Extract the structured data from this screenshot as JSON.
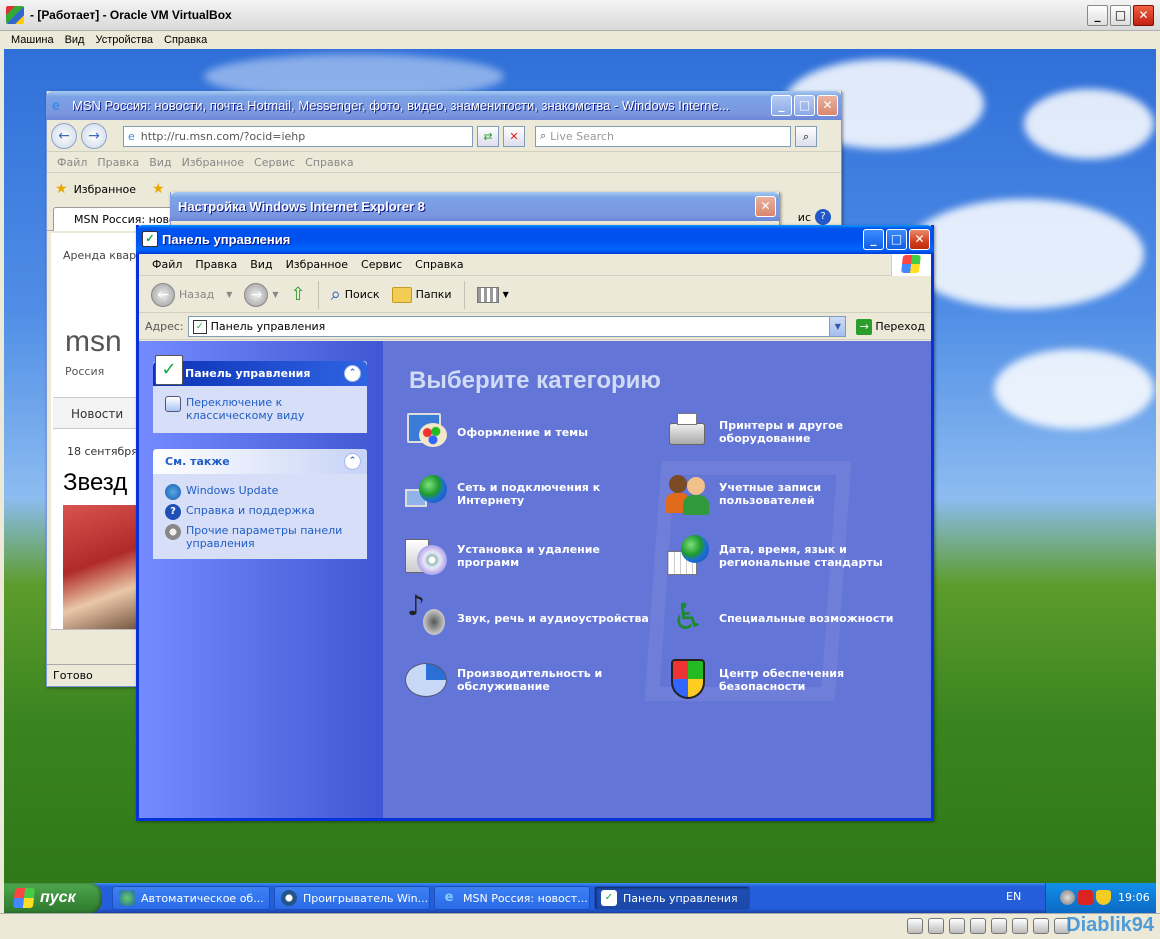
{
  "host": {
    "title": "- [Работает] - Oracle VM VirtualBox",
    "menu": [
      "Машина",
      "Вид",
      "Устройства",
      "Справка"
    ],
    "watermark": "Diablik94"
  },
  "ie": {
    "title": "MSN Россия: новости, почта Hotmail, Messenger, фото, видео, знаменитости, знакомства - Windows Interne...",
    "url": "http://ru.msn.com/?ocid=iehp",
    "search_placeholder": "Live Search",
    "menu": [
      "Файл",
      "Правка",
      "Вид",
      "Избранное",
      "Сервис",
      "Справка"
    ],
    "favorites_label": "Избранное",
    "tab_label": "MSN Россия: новос",
    "page_items": [
      "Аренда кварт",
      "msn",
      "Россия",
      "Новости",
      "18 сентября",
      "Звезд"
    ],
    "status": "Готово",
    "right_menu": "ис"
  },
  "dialog": {
    "title": "Настройка Windows Internet Explorer 8"
  },
  "cp": {
    "title": "Панель управления",
    "menu": [
      "Файл",
      "Правка",
      "Вид",
      "Избранное",
      "Сервис",
      "Справка"
    ],
    "toolbar": {
      "back": "Назад",
      "search": "Поиск",
      "folders": "Папки"
    },
    "address_label": "Адрес:",
    "address_value": "Панель управления",
    "go_label": "Переход",
    "left_panel": {
      "title": "Панель управления",
      "switch_link": "Переключение к классическому виду"
    },
    "see_also": {
      "title": "См. также",
      "links": [
        "Windows Update",
        "Справка и поддержка",
        "Прочие параметры панели управления"
      ]
    },
    "heading": "Выберите категорию",
    "categories": [
      "Оформление и темы",
      "Принтеры и другое оборудование",
      "Сеть и подключения к Интернету",
      "Учетные записи пользователей",
      "Установка и удаление программ",
      "Дата, время, язык и региональные стандарты",
      "Звук, речь и аудиоустройства",
      "Специальные возможности",
      "Производительность и обслуживание",
      "Центр обеспечения безопасности"
    ]
  },
  "taskbar": {
    "start": "пуск",
    "buttons": [
      "Автоматическое об...",
      "Проигрыватель Win...",
      "MSN Россия: новост...",
      "Панель управления"
    ],
    "lang": "EN",
    "clock": "19:06"
  },
  "colors": {
    "xp_blue": "#0053ee",
    "cp_main": "#6375d6",
    "start_green": "#3c8f3c",
    "link_blue": "#215dc6"
  }
}
